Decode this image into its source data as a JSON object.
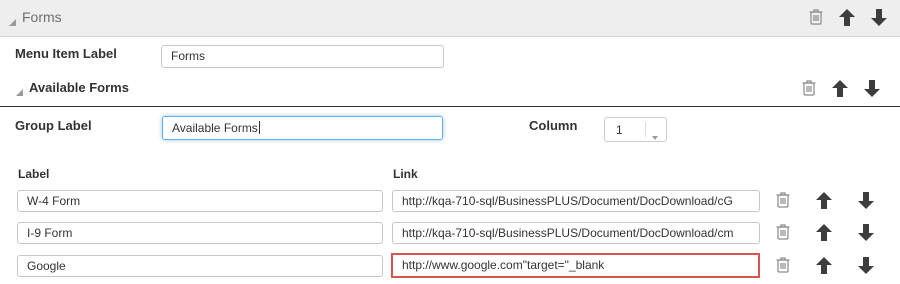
{
  "forms_header": {
    "title": "Forms"
  },
  "menu_item": {
    "label": "Menu Item Label",
    "value": "Forms"
  },
  "available_forms_header": {
    "title": "Available Forms"
  },
  "group": {
    "label": "Group Label",
    "value": "Available Forms",
    "column_label": "Column",
    "column_value": "1"
  },
  "table": {
    "col_label": "Label",
    "col_link": "Link",
    "rows": [
      {
        "label": "W-4 Form",
        "link": "http://kqa-710-sql/BusinessPLUS/Document/DocDownload/cG"
      },
      {
        "label": "I-9 Form",
        "link": "http://kqa-710-sql/BusinessPLUS/Document/DocDownload/cm"
      },
      {
        "label": "Google",
        "link": "http://www.google.com\"target=\"_blank"
      }
    ]
  },
  "colors": {
    "header_bg": "#eeeeee",
    "header_text": "#6e6e6e",
    "arrow": "#3d3d3d",
    "icon_gray": "#8a8a8a",
    "focus_blue": "#66afe9",
    "error_red": "#d9534f"
  }
}
